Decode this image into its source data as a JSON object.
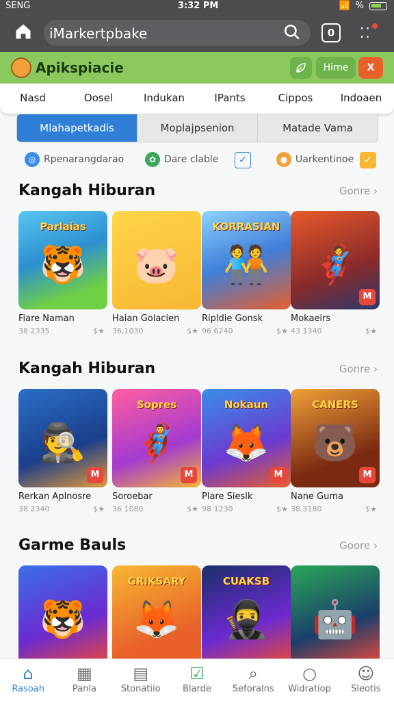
{
  "status": {
    "carrier": "SENG",
    "time": "3:32 PM",
    "battery": "%"
  },
  "browser": {
    "url": "iMarkertpbake",
    "tab_count": "0"
  },
  "app": {
    "title": "Apikspiacie",
    "actions": [
      "Hime",
      "X"
    ],
    "colors": {
      "bar": "#8bc95f",
      "accent": "#2f7fd6",
      "alert": "#e8483c"
    }
  },
  "subnav": [
    "Nasd",
    "Oosel",
    "Indukan",
    "IPants",
    "Cippos",
    "Indoaen"
  ],
  "segments": [
    "Mlahapetkadis",
    "Moplajpsenion",
    "Matade Vama"
  ],
  "filters": [
    {
      "icon": "globe-icon",
      "label": "Rpenarangdarao"
    },
    {
      "icon": "leaf-icon",
      "label": "Dare clable"
    },
    {
      "icon": "coin-icon",
      "label": "Uarkentinoe"
    }
  ],
  "sections": [
    {
      "title": "Kangah Hiburan",
      "more": "Gonre",
      "cards": [
        {
          "name": "Fiare Naman",
          "meta": "38 2335",
          "rating": "$",
          "banner": "Parlaias",
          "art": "🐯",
          "bg": "linear-gradient(160deg,#58c7f0,#2d8fd0 45%,#6fcf45 80%)",
          "badge": false
        },
        {
          "name": "Haian Golacien",
          "meta": "36,1030",
          "rating": "$",
          "banner": "",
          "art": "🐷",
          "bg": "linear-gradient(160deg,#ffd54a,#f7b733)",
          "badge": false
        },
        {
          "name": "Ripldie Gonsk",
          "meta": "96 6240",
          "rating": "$",
          "banner": "KORRASIAN",
          "art": "🧑‍🤝‍🧑",
          "bg": "linear-gradient(160deg,#8fd3ff,#3f7ed8 50%,#e85f2b)",
          "badge": false
        },
        {
          "name": "Mokaeirs",
          "meta": "43 1340",
          "rating": "$",
          "banner": "",
          "art": "🦸",
          "bg": "linear-gradient(160deg,#e85a2a,#8a2a2a 60%,#2a3a6a)",
          "badge": true
        }
      ]
    },
    {
      "title": "Kangah Hiburan",
      "more": "Gonre",
      "cards": [
        {
          "name": "Rerkan Aplnosre",
          "meta": "38 2340",
          "rating": "$",
          "banner": "",
          "art": "🕵️",
          "bg": "linear-gradient(160deg,#2a6fc8,#1b3e8a 60%,#e39b3a)",
          "badge": true
        },
        {
          "name": "Soroebar",
          "meta": "36 1080",
          "rating": "$",
          "banner": "Sopres",
          "art": "🦸‍♂️",
          "bg": "linear-gradient(160deg,#ff5fa0,#a43ad0 60%,#f7b733)",
          "badge": true
        },
        {
          "name": "Plare Sieslk",
          "meta": "98 1230",
          "rating": "$",
          "banner": "Nokaun",
          "art": "🦊",
          "bg": "linear-gradient(160deg,#3a8ee8,#6b3ad0 60%,#e85f2b)",
          "badge": true
        },
        {
          "name": "Nane Guma",
          "meta": "38.3180",
          "rating": "$",
          "banner": "CANERS",
          "art": "🐻",
          "bg": "linear-gradient(160deg,#f0a03a,#7a2a10 70%)",
          "badge": true
        }
      ]
    },
    {
      "title": "Garme Bauls",
      "more": "Goore",
      "cards": [
        {
          "name": "",
          "meta": "",
          "rating": "",
          "banner": "",
          "art": "🐯",
          "bg": "linear-gradient(160deg,#3a6fe8,#6b2ad0 60%,#e8483c)",
          "badge": false
        },
        {
          "name": "",
          "meta": "",
          "rating": "",
          "banner": "GRIKSARY",
          "art": "🦊",
          "bg": "linear-gradient(160deg,#f7b733,#e8612a 70%)",
          "badge": false
        },
        {
          "name": "",
          "meta": "",
          "rating": "",
          "banner": "CUAKSB",
          "art": "🥷",
          "bg": "linear-gradient(160deg,#1b2e6a,#6b2ad0 60%,#e8483c)",
          "badge": false
        },
        {
          "name": "",
          "meta": "",
          "rating": "",
          "banner": "",
          "art": "🤖",
          "bg": "linear-gradient(160deg,#2aa858,#1b3e6a 60%,#e8483c)",
          "badge": false
        }
      ]
    }
  ],
  "bottomnav": [
    {
      "label": "Rasoah",
      "icon": "home-icon"
    },
    {
      "label": "Panla",
      "icon": "grid-icon"
    },
    {
      "label": "Stonatiio",
      "icon": "news-icon"
    },
    {
      "label": "Blarde",
      "icon": "check-icon"
    },
    {
      "label": "Seforalns",
      "icon": "search-icon"
    },
    {
      "label": "Widratiop",
      "icon": "circle-icon"
    },
    {
      "label": "Sleotis",
      "icon": "user-icon"
    }
  ]
}
